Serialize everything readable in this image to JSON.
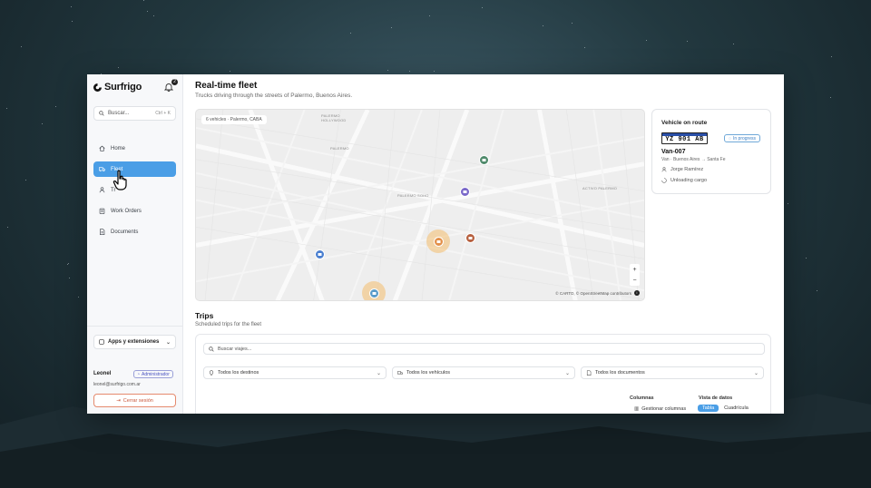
{
  "sidebar": {
    "brand": "Surfrigo",
    "notification_count": "2",
    "search": {
      "placeholder": "Buscar...",
      "shortcut": "Ctrl + K"
    },
    "nav": [
      {
        "label": "Home",
        "icon": "home-icon"
      },
      {
        "label": "Fleet",
        "icon": "truck-icon",
        "active": true
      },
      {
        "label": "Tr",
        "icon": "people-icon"
      },
      {
        "label": "Work Orders",
        "icon": "clipboard-icon"
      },
      {
        "label": "Documents",
        "icon": "document-icon"
      }
    ],
    "apps_label": "Apps y extensiones",
    "user": {
      "name": "Leonel",
      "role": "Administrador",
      "email": "leonel@surfrigo.com.ar"
    },
    "logout_label": "Cerrar sesión"
  },
  "header": {
    "title": "Real-time fleet",
    "subtitle": "Trucks driving through the streets of Palermo, Buenos Aires."
  },
  "map": {
    "chip": "6 vehicles · Palermo, CABA",
    "labels": [
      "PALERMO HOLLYWOOD",
      "PALERMO",
      "PALERMO SOHO",
      "ACTIVO PALERMO"
    ],
    "zoom_in": "+",
    "zoom_out": "−",
    "attribution": "© CARTO, © OpenStreetMap contributors",
    "info": "i",
    "marker_colors": [
      "#4f8a6b",
      "#7a68c9",
      "#e3904a",
      "#b7603f",
      "#4a7fd0",
      "#5a9bc9"
    ]
  },
  "vehicle": {
    "title": "Vehicle on route",
    "plate": "YZ 901 AB",
    "status": "In progress",
    "name": "Van-007",
    "route": "Van · Buenos Aires → Santa Fe",
    "driver": "Jorge Ramírez",
    "state": "Unloading cargo"
  },
  "trips": {
    "title": "Trips",
    "subtitle": "Scheduled trips for the fleet",
    "search_placeholder": "Buscar viajes...",
    "filters": [
      "Todos los destinos",
      "Todos los vehículos",
      "Todos los documentos"
    ],
    "columns_label": "Columnas",
    "view_label": "Vista de datos",
    "manage_columns": "Gestionar columnas",
    "view_table": "Tabla",
    "view_grid": "Cuadrícula"
  },
  "colors": {
    "accent": "#4a9ee6",
    "logout": "#c8563a",
    "role": "#4b54c2"
  }
}
